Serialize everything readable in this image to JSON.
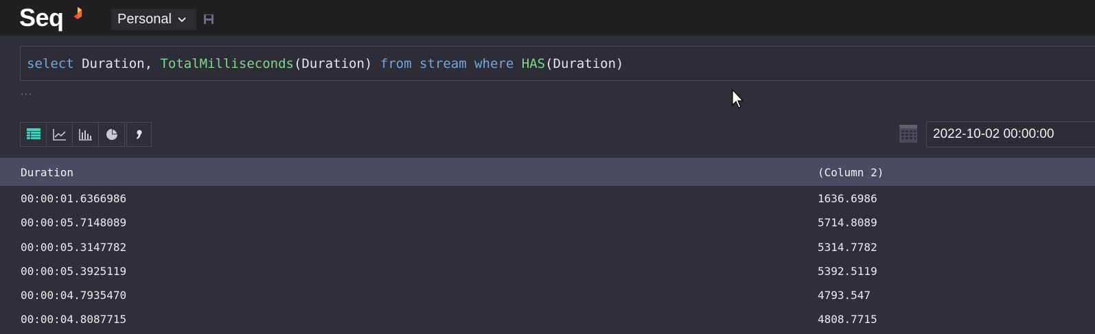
{
  "app": {
    "logo_text": "Seq",
    "workspace_label": "Personal"
  },
  "query": {
    "tokens": [
      {
        "text": "select",
        "kind": "kw"
      },
      {
        "text": " Duration, ",
        "kind": "tx"
      },
      {
        "text": "TotalMilliseconds",
        "kind": "fn"
      },
      {
        "text": "(Duration) ",
        "kind": "tx"
      },
      {
        "text": "from",
        "kind": "kw"
      },
      {
        "text": " ",
        "kind": "tx"
      },
      {
        "text": "stream",
        "kind": "kw"
      },
      {
        "text": " ",
        "kind": "tx"
      },
      {
        "text": "where",
        "kind": "kw"
      },
      {
        "text": " ",
        "kind": "tx"
      },
      {
        "text": "HAS",
        "kind": "fn"
      },
      {
        "text": "(Duration)",
        "kind": "tx"
      }
    ],
    "more_indicator": "···"
  },
  "toolbar": {
    "view_buttons": [
      "table-icon",
      "line-chart-icon",
      "bar-chart-icon",
      "pie-chart-icon"
    ],
    "extra_button": "comma-icon",
    "date_value": "2022-10-02 00:00:00"
  },
  "results": {
    "columns": [
      "Duration",
      "(Column 2)"
    ],
    "rows": [
      [
        "00:00:01.6366986",
        "1636.6986"
      ],
      [
        "00:00:05.7148089",
        "5714.8089"
      ],
      [
        "00:00:05.3147782",
        "5314.7782"
      ],
      [
        "00:00:05.3925119",
        "5392.5119"
      ],
      [
        "00:00:04.7935470",
        "4793.547"
      ],
      [
        "00:00:04.8087715",
        "4808.7715"
      ]
    ]
  },
  "colors": {
    "accent_orange": "#f26b2a",
    "accent_yellow": "#f5c342",
    "table_icon_teal": "#3fd1b8",
    "keyword_blue": "#6fa8dc",
    "function_green": "#7fd68a",
    "header_bg": "#4a4a62"
  }
}
